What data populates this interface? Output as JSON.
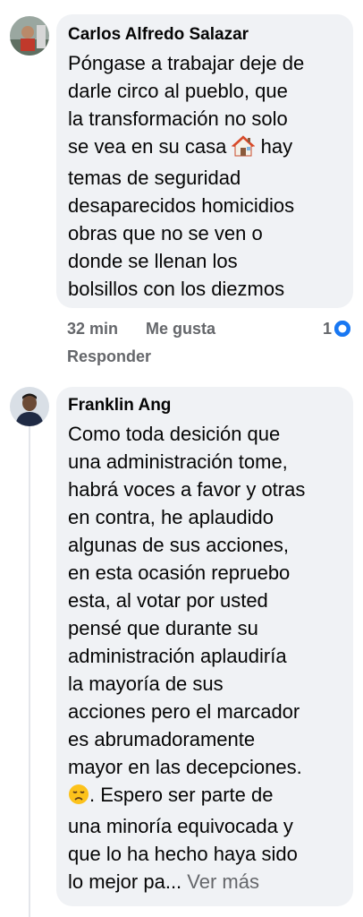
{
  "comments": [
    {
      "author": "Carlos Alfredo Salazar",
      "lines": [
        "Póngase a trabajar deje de",
        "darle circo al pueblo, que",
        "la transformación no solo",
        "se vea en su casa",
        "temas de seguridad",
        "desaparecidos homicidios",
        "obras que no se ven o",
        "donde se llenan los",
        "bolsillos con los diezmos"
      ],
      "line4_after_emoji": "hay",
      "emoji": "house-emoji",
      "time": "32 min",
      "like_label": "Me gusta",
      "reaction_count": "1",
      "reply_label": "Responder"
    },
    {
      "author": "Franklin Ang",
      "lines": [
        "Como toda desición que",
        "una administración tome,",
        "habrá voces a favor y otras",
        "en contra, he aplaudido",
        "algunas de sus acciones,",
        "en esta ocasión repruebo",
        "esta, al votar por usted",
        "pensé que durante  su",
        "administración aplaudiría",
        "la mayoría de sus",
        "acciones pero el marcador",
        "es abrumadoramente",
        "mayor en las decepciones.",
        ". Espero ser parte de",
        "una minoría equivocada y",
        "que lo ha  hecho haya sido",
        "lo mejor pa..."
      ],
      "emoji": "disappointed-face-emoji",
      "see_more": "Ver más"
    }
  ],
  "colors": {
    "bubble": "#f0f2f5",
    "meta": "#65676b",
    "accent": "#1877f2"
  }
}
